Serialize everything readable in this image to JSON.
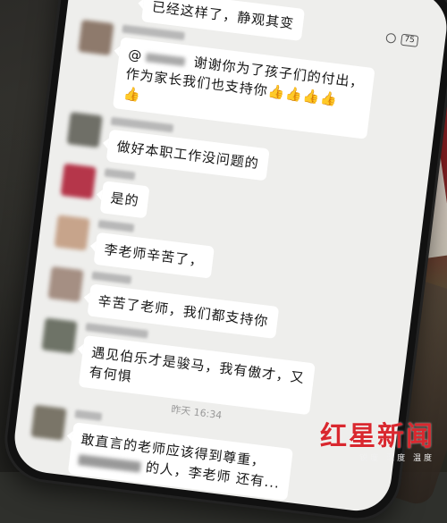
{
  "status_bar": {
    "time": "",
    "battery": "75"
  },
  "messages": [
    {
      "id": "m1",
      "text": "已经这样了，静观其变"
    },
    {
      "id": "m2",
      "mention": "@",
      "line1": "谢谢你为了孩子们的付出，",
      "line2": "作为家长我们也支持你",
      "line2_emoji": "👍👍👍👍",
      "line3_emoji": "👍"
    },
    {
      "id": "m3",
      "text": "做好本职工作没问题的"
    },
    {
      "id": "m4",
      "text": "是的"
    },
    {
      "id": "m5",
      "text": "李老师辛苦了，"
    },
    {
      "id": "m6",
      "text": "辛苦了老师，我们都支持你"
    },
    {
      "id": "m7",
      "line1": "遇见伯乐才是骏马，我有傲才，又",
      "line2": "有何惧"
    },
    {
      "id": "m8",
      "line1": "敢直言的老师应该得到尊重，",
      "line2": "的人，李老师",
      "line2_tail": "还有..."
    }
  ],
  "timestamp": "昨天 16:34",
  "watermark": {
    "title": "红星新闻",
    "subtitle": "锐度 深度 温度"
  },
  "colors": {
    "watermark_red": "#d9282f",
    "bubble": "#ffffff",
    "chat_bg": "#eeeeec"
  }
}
